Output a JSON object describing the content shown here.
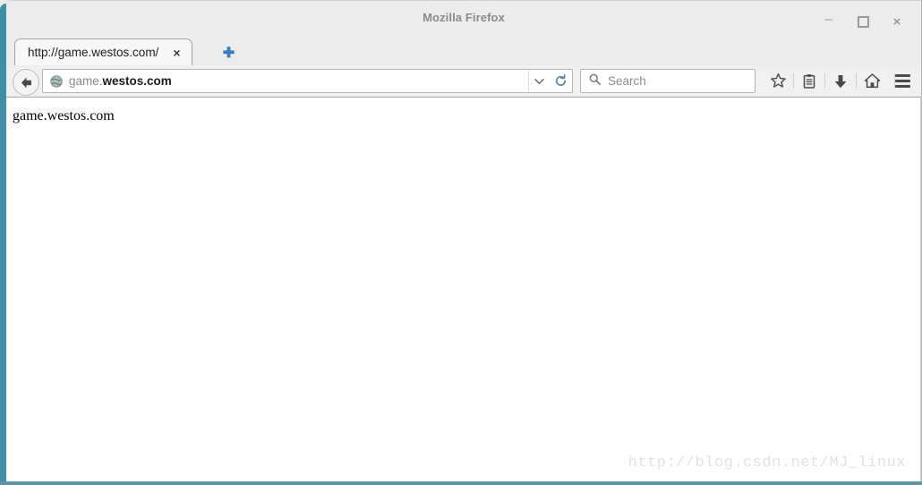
{
  "window": {
    "title": "Mozilla Firefox",
    "controls": {
      "minimize_label": "–",
      "maximize_label": "",
      "close_label": "×"
    },
    "frame_color": "#4090a5"
  },
  "tabs": {
    "items": [
      {
        "title": "http://game.westos.com/",
        "close_label": "×"
      }
    ],
    "new_tab_label": "+",
    "new_tab_color": "#3a7cb8"
  },
  "toolbar": {
    "back_label": "←",
    "url": {
      "prefix": "game.",
      "domain": "westos.com",
      "dropdown_label": "⌄",
      "reload_label": "↻"
    },
    "search": {
      "placeholder": "Search",
      "value": ""
    },
    "icons": [
      {
        "name": "bookmark-star-icon"
      },
      {
        "name": "reading-list-icon"
      },
      {
        "name": "downloads-icon"
      },
      {
        "name": "home-icon"
      }
    ],
    "menu_label": "☰"
  },
  "page": {
    "body_text": "game.westos.com",
    "watermark": "http://blog.csdn.net/MJ_linux"
  }
}
